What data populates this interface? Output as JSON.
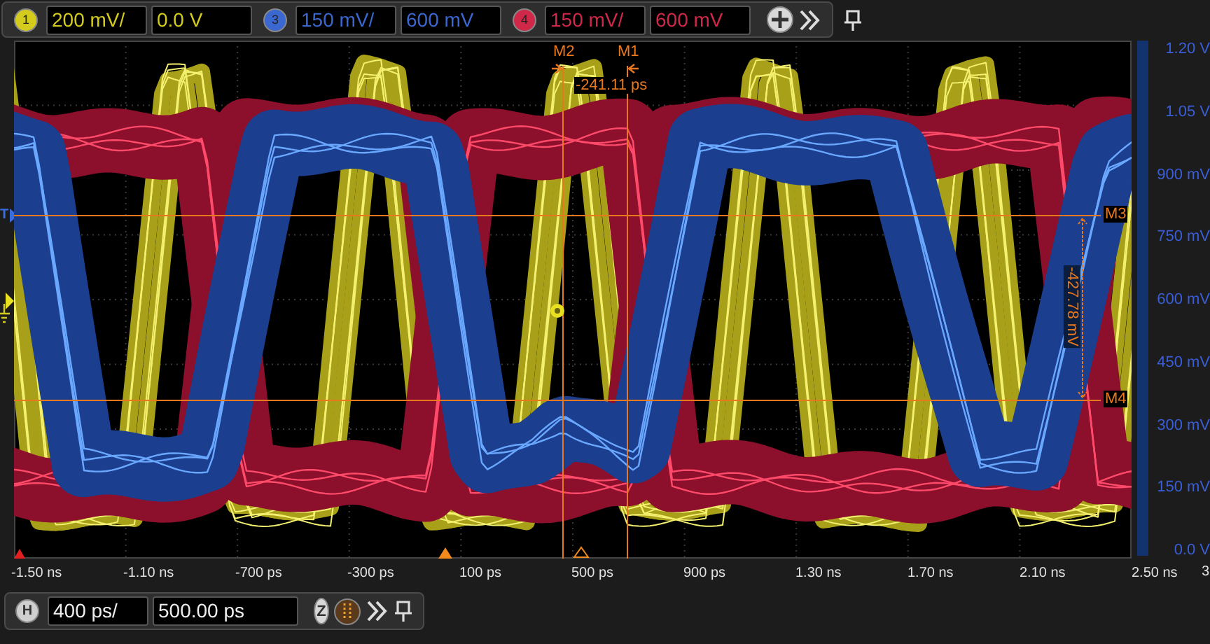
{
  "top_toolbar": {
    "channels": [
      {
        "number": "1",
        "scale": "200 mV/",
        "offset": "0.0 V",
        "color": "#d4cc1c"
      },
      {
        "number": "3",
        "scale": "150 mV/",
        "offset": "600 mV",
        "color": "#3a68d0"
      },
      {
        "number": "4",
        "scale": "150 mV/",
        "offset": "600 mV",
        "color": "#d02848"
      }
    ]
  },
  "plot": {
    "trigger_label": "T",
    "markers": [
      {
        "label": "M2",
        "kind": "vertical"
      },
      {
        "label": "M1",
        "kind": "vertical"
      },
      {
        "label": "M3",
        "kind": "horizontal"
      },
      {
        "label": "M4",
        "kind": "horizontal"
      }
    ],
    "delta_time": "-241.11 ps",
    "delta_voltage": "-427.78 mV"
  },
  "y_axis": {
    "labels": [
      "1.20 V",
      "1.05 V",
      "900 mV",
      "750 mV",
      "600 mV",
      "450 mV",
      "300 mV",
      "150 mV",
      "0.0 V"
    ]
  },
  "x_axis": {
    "labels": [
      "-1.50 ns",
      "-1.10 ns",
      "-700 ps",
      "-300 ps",
      "100 ps",
      "500 ps",
      "900 ps",
      "1.30 ns",
      "1.70 ns",
      "2.10 ns",
      "2.50 ns"
    ],
    "edge_label": "3"
  },
  "bottom_toolbar": {
    "label": "H",
    "scale": "400 ps/",
    "position": "500.00 ps",
    "zoom_label": "Z"
  }
}
